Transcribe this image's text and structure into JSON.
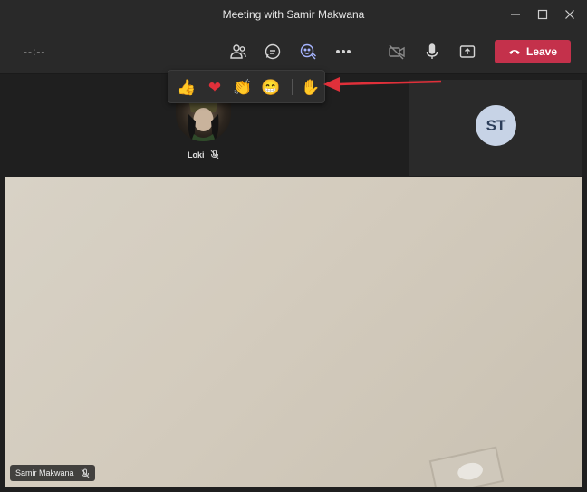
{
  "window": {
    "title": "Meeting with Samir Makwana"
  },
  "toolbar": {
    "timer": "--:--",
    "leave_label": "Leave"
  },
  "participants": {
    "loki_name": "Loki",
    "st_initials": "ST",
    "samir_name": "Samir Makwana"
  },
  "reactions": [
    {
      "name": "like",
      "glyph": "👍"
    },
    {
      "name": "heart",
      "glyph": "❤"
    },
    {
      "name": "applause",
      "glyph": "👏"
    },
    {
      "name": "laugh",
      "glyph": "😁"
    },
    {
      "name": "raise-hand",
      "glyph": "✋"
    }
  ],
  "colors": {
    "leave": "#c4314b",
    "arrow": "#e0303a",
    "avatar_st": "#c7d3e6"
  }
}
